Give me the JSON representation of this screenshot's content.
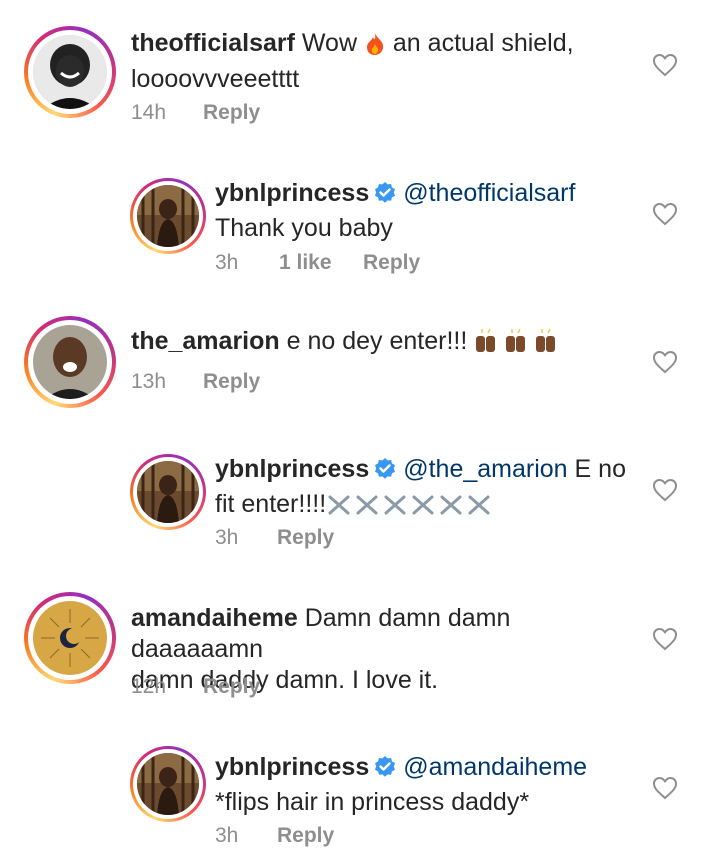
{
  "comments": [
    {
      "username": "theofficialsarf",
      "text_a": "Wow",
      "emoji": "fire",
      "text_b": "an actual shield,",
      "line2": "loooovvveeetttt",
      "time": "14h",
      "reply": "Reply"
    },
    {
      "username": "ybnlprincess",
      "mention": "@theofficialsarf",
      "line2": "Thank you baby",
      "time": "3h",
      "likes": "1 like",
      "reply": "Reply"
    },
    {
      "username": "the_amarion",
      "text": "e no dey enter!!!",
      "emoji": "raising-hands x3",
      "time": "13h",
      "reply": "Reply"
    },
    {
      "username": "ybnlprincess",
      "mention": "@the_amarion",
      "text": "E no",
      "line2": "fit enter!!!!",
      "emoji": "crossed-swords x6",
      "time": "3h",
      "reply": "Reply"
    },
    {
      "username": "amandaiheme",
      "text": "Damn damn damn daaaaaamn",
      "line2": "damn daddy damn. I love it.",
      "time": "12h",
      "reply": "Reply"
    },
    {
      "username": "ybnlprincess",
      "mention": "@amandaiheme",
      "line2": "*flips hair in princess daddy*",
      "time": "3h",
      "reply": "Reply"
    }
  ],
  "colors": {
    "text": "#262626",
    "muted": "#8e8e8e",
    "mention": "#00376b",
    "verified": "#3897f0"
  }
}
